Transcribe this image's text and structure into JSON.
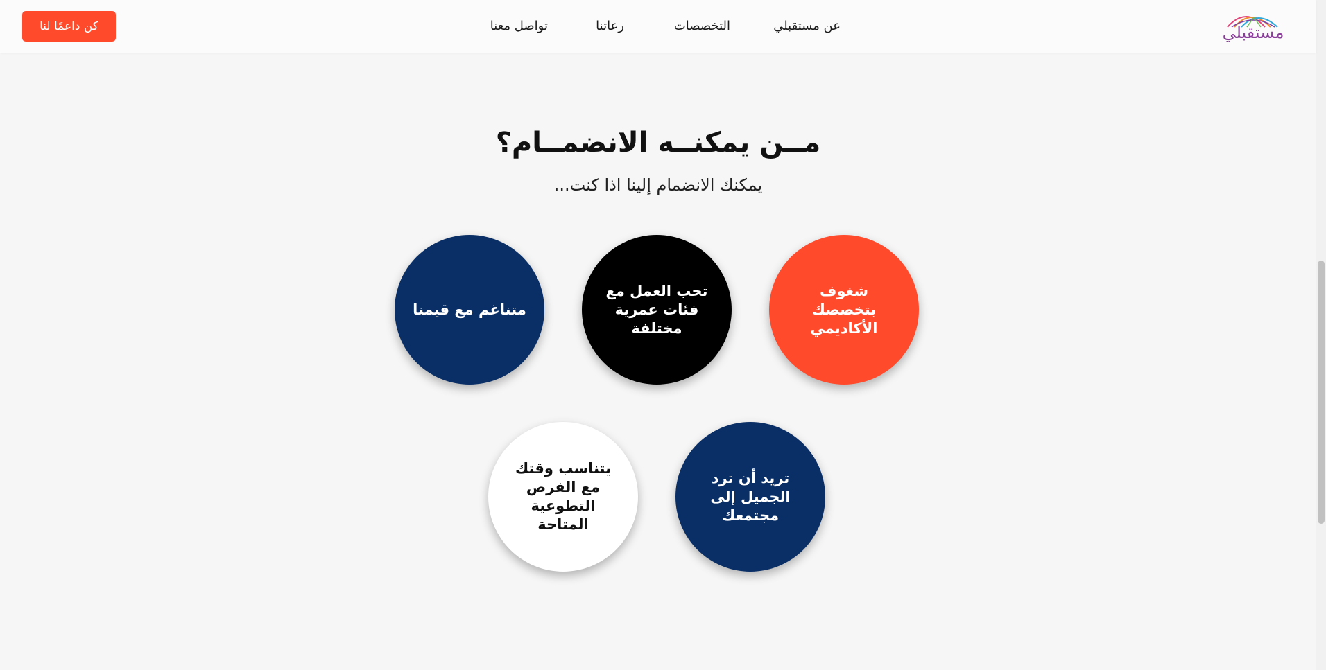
{
  "nav": {
    "logo_text": "مستقبلي",
    "links": [
      "عن مستقبلي",
      "التخصصات",
      "رعاتنا",
      "تواصل معنا"
    ],
    "cta_label": "كن داعمًا لنا"
  },
  "section": {
    "title": "مــن يمكنــه الانضمــام؟",
    "subtitle": "يمكنك الانضمام إلينا اذا كنت...",
    "circles": [
      {
        "label": "شغوف بتخصصك الأكاديمي",
        "color": "#ff4a2c"
      },
      {
        "label": "تحب العمل مع فئات عمرية مختلفة",
        "color": "#000000"
      },
      {
        "label": "متناغم مع قيمنا",
        "color": "#0a2f66"
      },
      {
        "label": "تريد أن ترد الجميل إلى مجتمعك",
        "color": "#0a2f66"
      },
      {
        "label": "يتناسب وقتك مع الفرص التطوعية المتاحة",
        "color": "#ffffff"
      }
    ]
  },
  "colors": {
    "accent": "#ff4a2c",
    "navy": "#0a2f66",
    "background": "#f6f6f6"
  }
}
